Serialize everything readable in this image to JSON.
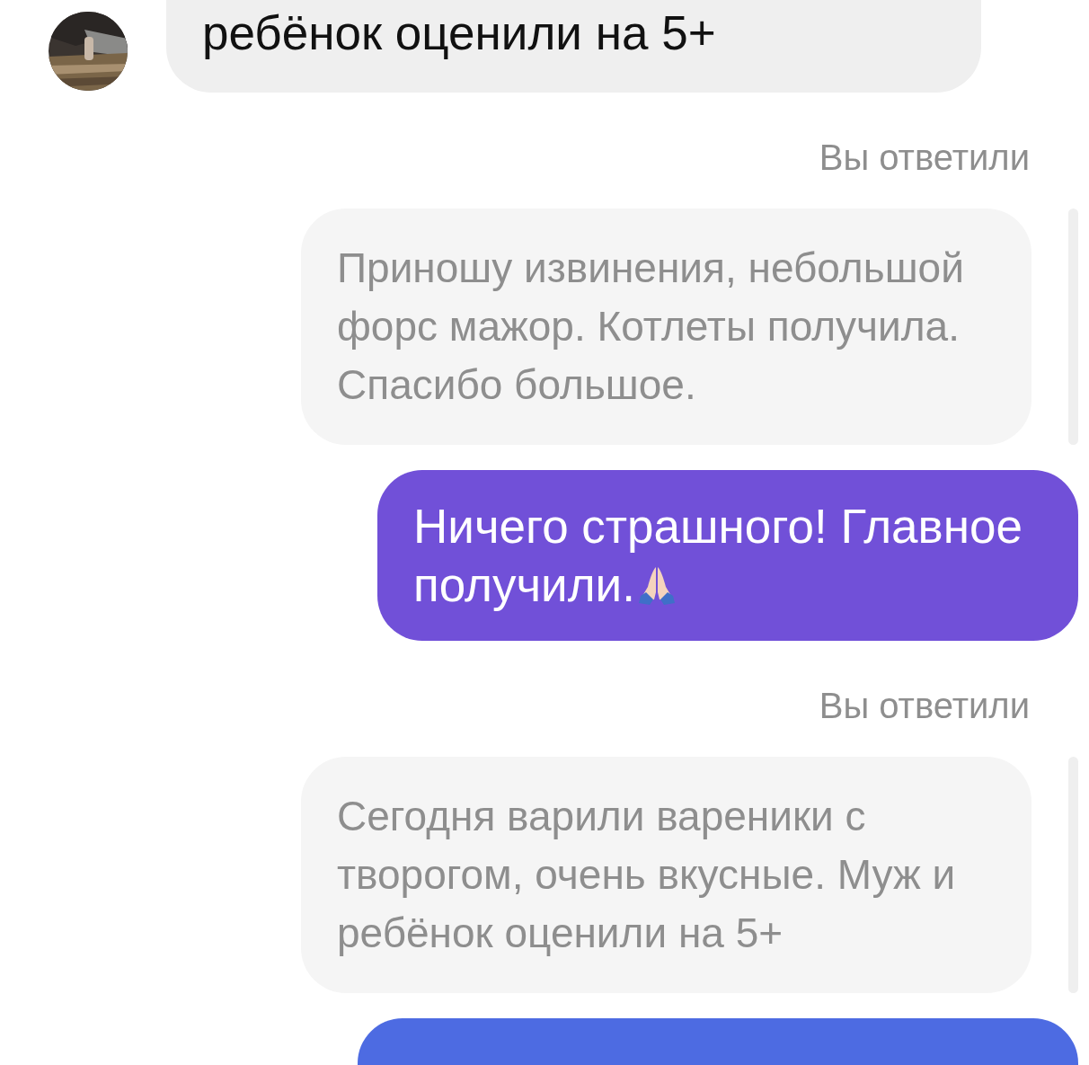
{
  "messages": [
    {
      "kind": "received",
      "text": "ребёнок оценили на 5+"
    },
    {
      "kind": "reply_label",
      "text": "Вы ответили"
    },
    {
      "kind": "quoted",
      "text": "Приношу извинения, небольшой форс мажор. Котлеты получила. Спасибо большое."
    },
    {
      "kind": "sent",
      "color": "#7150d8",
      "text": "Ничего страшного! Главное получили.",
      "emoji_icon": true
    },
    {
      "kind": "reply_label",
      "text": "Вы ответили"
    },
    {
      "kind": "quoted",
      "text": "Сегодня варили вареники с творогом, очень вкусные. Муж и ребёнок оценили на 5+"
    },
    {
      "kind": "sent",
      "color": "#4d6be2"
    }
  ]
}
